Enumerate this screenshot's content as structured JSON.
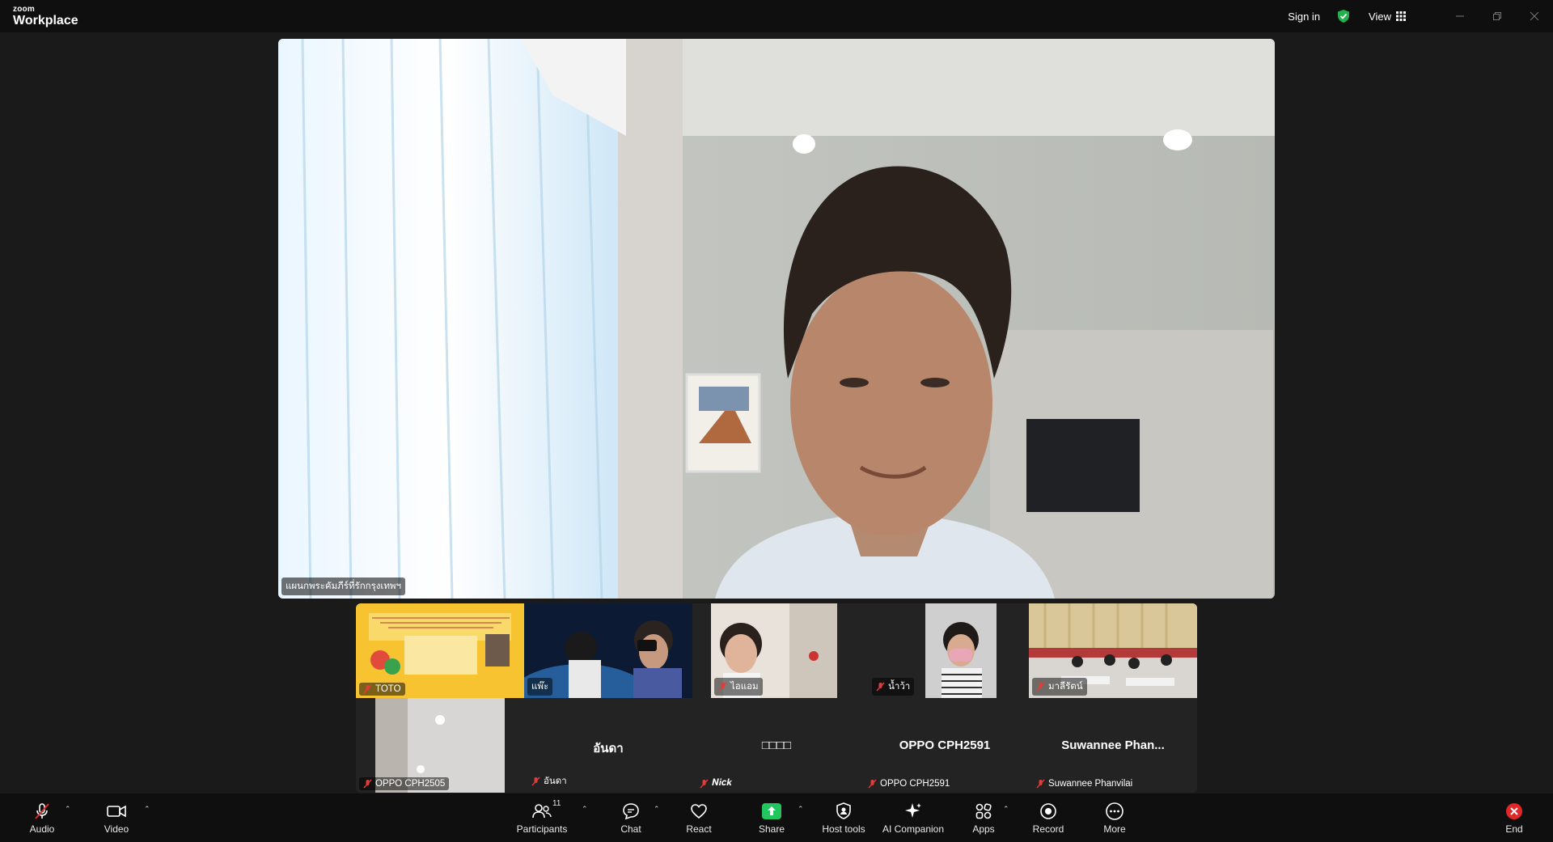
{
  "app": {
    "brand_small": "zoom",
    "brand_large": "Workplace"
  },
  "titlebar": {
    "signin_label": "Sign in",
    "view_label": "View"
  },
  "speaker": {
    "name": "แผนกพระคัมภีร์ที่รักกรุงเทพฯ"
  },
  "gallery": {
    "tiles": [
      {
        "name": "TOTO",
        "big": ""
      },
      {
        "name": "แพ๊ะ",
        "big": ""
      },
      {
        "name": "ไอแอม",
        "big": ""
      },
      {
        "name": "น้ำว้า",
        "big": ""
      },
      {
        "name": "มาลีรัตน์",
        "big": ""
      },
      {
        "name": "OPPO CPH2505",
        "big": ""
      },
      {
        "name": "อันดา",
        "big": "อันดา"
      },
      {
        "name": "𝑵𝒊𝒄𝒌",
        "big": "□□□□"
      },
      {
        "name": "OPPO CPH2591",
        "big": "OPPO CPH2591"
      },
      {
        "name": "Suwannee  Phanvilai",
        "big": "Suwannee   Phan..."
      }
    ]
  },
  "toolbar": {
    "audio": "Audio",
    "video": "Video",
    "participants": "Participants",
    "participants_count": "11",
    "chat": "Chat",
    "react": "React",
    "share": "Share",
    "host_tools": "Host tools",
    "ai_companion": "AI Companion",
    "apps": "Apps",
    "record": "Record",
    "more": "More",
    "end": "End"
  },
  "colors": {
    "share_green": "#22c55e",
    "end_red": "#e02828",
    "shield_green": "#22b14c"
  }
}
